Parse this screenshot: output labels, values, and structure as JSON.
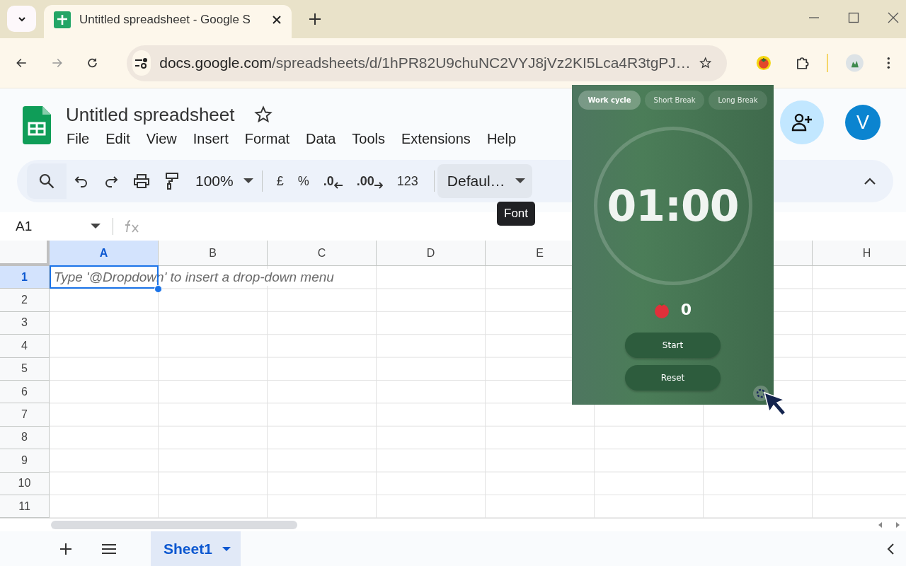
{
  "browser": {
    "tab_title": "Untitled spreadsheet - Google S",
    "url_host": "docs.google.com",
    "url_path": "/spreadsheets/d/1hPR82U9chuNC2VYJ8jVz2KI5Lca4R3tgPJ…"
  },
  "doc": {
    "title": "Untitled spreadsheet",
    "menu": [
      "File",
      "Edit",
      "View",
      "Insert",
      "Format",
      "Data",
      "Tools",
      "Extensions",
      "Help"
    ],
    "avatar": "V"
  },
  "toolbar": {
    "zoom": "100%",
    "items": [
      {
        "kind": "text",
        "label": "£"
      },
      {
        "kind": "text",
        "label": "%"
      },
      {
        "kind": "decrease",
        "label": ".0"
      },
      {
        "kind": "increase",
        "label": ".00"
      },
      {
        "kind": "text",
        "label": "123"
      }
    ],
    "font": "Defaul…",
    "tooltip": "Font"
  },
  "formula_bar": {
    "cell": "A1"
  },
  "grid": {
    "columns": [
      {
        "label": "A",
        "selected": true
      },
      {
        "label": "B",
        "selected": false
      },
      {
        "label": "C",
        "selected": false
      },
      {
        "label": "D",
        "selected": false
      },
      {
        "label": "E",
        "selected": false
      }
    ],
    "columns_right": [
      {
        "label": "H",
        "selected": false
      }
    ],
    "rows": [
      {
        "label": "1",
        "selected": true
      },
      {
        "label": "2",
        "selected": false
      },
      {
        "label": "3",
        "selected": false
      },
      {
        "label": "4",
        "selected": false
      },
      {
        "label": "5",
        "selected": false
      },
      {
        "label": "6",
        "selected": false
      },
      {
        "label": "7",
        "selected": false
      },
      {
        "label": "8",
        "selected": false
      },
      {
        "label": "9",
        "selected": false
      },
      {
        "label": "10",
        "selected": false
      },
      {
        "label": "11",
        "selected": false
      }
    ],
    "hint": "Type '@Dropdown' to insert a drop-down menu"
  },
  "sheets": [
    {
      "label": "Sheet1",
      "selected": true
    }
  ],
  "timer": {
    "modes": [
      {
        "label": "Work cycle",
        "selected": true
      },
      {
        "label": "Short Break",
        "selected": false
      },
      {
        "label": "Long Break",
        "selected": false
      }
    ],
    "time": "01:00",
    "count": "0",
    "buttons": [
      "Start",
      "Reset"
    ]
  }
}
